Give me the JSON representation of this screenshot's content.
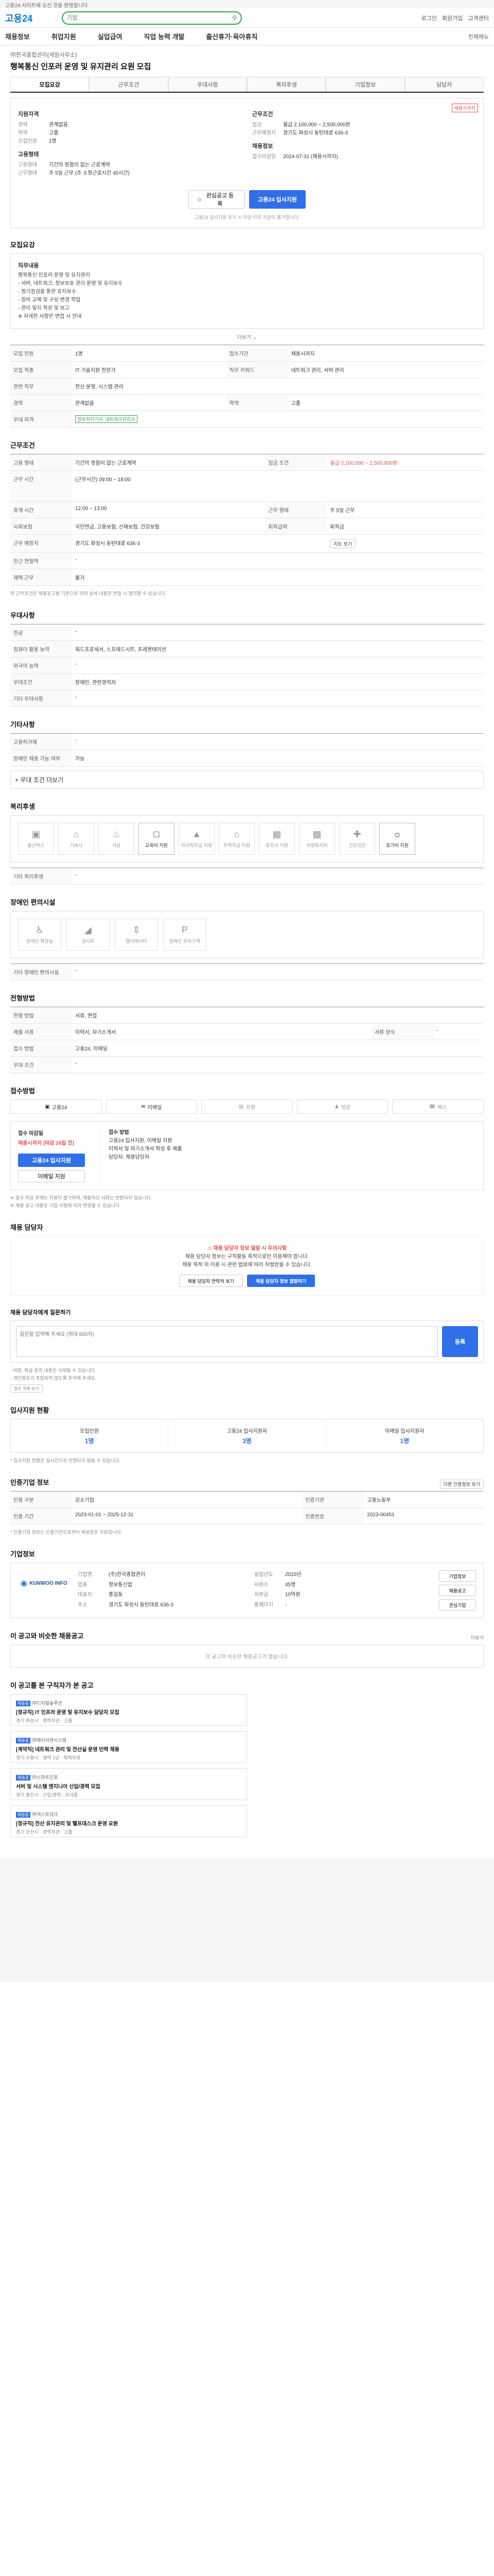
{
  "notice": "고용24 사이트에 오신 것을 환영합니다",
  "header": {
    "logo": "고용24",
    "search_placeholder": "기업",
    "links": [
      "로그인",
      "회원가입",
      "고객센터"
    ]
  },
  "gnb": {
    "items": [
      "채용정보",
      "취업지원",
      "실업급여",
      "직업 능력 개발",
      "출산휴가·육아휴직"
    ],
    "right": "전체메뉴"
  },
  "job": {
    "company": "㈜한국종합관리(세원사무소)",
    "title": "행복통신 인포러 운영 및 유지관리 요원 모집"
  },
  "tabs": [
    "모집요강",
    "근무조건",
    "우대사항",
    "복리후생",
    "기업정보",
    "담당자"
  ],
  "summary": {
    "badge": "채용시까지",
    "left_title": "지원자격",
    "left_rows": [
      {
        "k": "경력",
        "v": "관계없음"
      },
      {
        "k": "학력",
        "v": "고졸"
      },
      {
        "k": "모집인원",
        "v": "1명"
      }
    ],
    "left_title2": "고용형태",
    "left_rows2": [
      {
        "k": "고용형태",
        "v": "기간의 정함이 없는 근로계약"
      },
      {
        "k": "근무형태",
        "v": "주 5일 근무 (주 소정근로시간 40시간)"
      }
    ],
    "right_title": "근무조건",
    "right_rows": [
      {
        "k": "임금",
        "v": "월급 2,100,000 ~ 2,500,000원"
      },
      {
        "k": "근무예정지",
        "v": "경기도 화성시 동탄대로 636-3"
      }
    ],
    "right_title2": "채용정보",
    "right_rows2": [
      {
        "k": "접수마감일",
        "v": "2024-07-31 (채용시까지)"
      }
    ],
    "btn_scrap": "관심공고 등록",
    "btn_apply": "고용24 입사지원",
    "note": "고용24 입사지원 포기 시 마감 이후 지원이 불가합니다."
  },
  "sections": {
    "recruit": "모집요강",
    "conditions": "근무조건",
    "preferred": "우대사항",
    "etc": "기타사항",
    "welfare": "복리후생",
    "barrier": "장애인 편의시설",
    "method": "전형방법",
    "process": "접수방법",
    "report": "채용 담당자",
    "qa": "입사지원 Q&A",
    "status": "입사지원 현황",
    "homepage": "인증기업 정보",
    "company": "기업정보",
    "similar": "이 공고와 비슷한 채용공고"
  },
  "duty": {
    "title": "직무내용",
    "lines": [
      "행복통신 인포러 운영 및 유지관리",
      "- 서버, 네트워크, 정보보호 관리 운영 및 유지보수",
      "- 정기점검을 통한 유지보수",
      "- 장비 교체 및 구성 변경 작업",
      "- 관리 일지 작성 및 보고",
      "※ 자세한 사항은 면접 시 안내"
    ],
    "more": "더보기"
  },
  "recruit_table": [
    {
      "k": "모집 인원",
      "v": "1명",
      "k2": "접수기간",
      "v2": "채용시까지"
    },
    {
      "k": "모집 직종",
      "v": "IT 기술지원 전문가",
      "k2": "직무 키워드",
      "v2": "네트워크 관리, 서버 관리"
    },
    {
      "k": "관련 직무",
      "v": "전산 운영, 시스템 관리",
      "k2": "",
      "v2": ""
    },
    {
      "k": "경력",
      "v": "관계없음",
      "k2": "학력",
      "v2": "고졸"
    },
    {
      "k": "우대 자격",
      "v": "정보처리기사, 네트워크관리사",
      "k2": "",
      "v2": ""
    }
  ],
  "cond_table": [
    {
      "k": "고용 형태",
      "v": "기간의 정함이 없는 근로계약",
      "k2": "임금 조건",
      "v2": "월급 2,100,000 ~ 2,500,000원"
    },
    {
      "k": "근무 시간",
      "v": "(근무시간) 09:00 ~ 18:00",
      "k2": "",
      "v2": ""
    },
    {
      "k": "휴게 시간",
      "v": "12:00 ~ 13:00",
      "k2": "근무 형태",
      "v2": "주 5일 근무"
    },
    {
      "k": "사회보험",
      "v": "국민연금, 고용보험, 산재보험, 건강보험",
      "k2": "퇴직급여",
      "v2": "퇴직금"
    },
    {
      "k": "근무 예정지",
      "v": "경기도 화성시 동탄대로 636-3",
      "k2": "",
      "v2": "지도 보기"
    },
    {
      "k": "인근 전철역",
      "v": "-",
      "k2": "",
      "v2": ""
    },
    {
      "k": "재택 근무",
      "v": "불가",
      "k2": "",
      "v2": ""
    }
  ],
  "cond_note": "위 근무조건은 채용공고를 기준으로 하며 상세 내용은 면접 시 협의할 수 있습니다.",
  "pref_table": [
    {
      "k": "전공",
      "v": "-"
    },
    {
      "k": "컴퓨터 활용 능력",
      "v": "워드프로세서, 스프레드시트, 프레젠테이션"
    },
    {
      "k": "외국어 능력",
      "v": "-"
    },
    {
      "k": "우대조건",
      "v": "장애인, 관련경력자"
    },
    {
      "k": "기타 우대사항",
      "v": "-"
    }
  ],
  "etc_table": [
    {
      "k": "고용허가제",
      "v": "-"
    },
    {
      "k": "장애인 채용 가능 여부",
      "v": "가능"
    }
  ],
  "etc_more": "우대 조건 더보기",
  "welfare": [
    {
      "name": "통근버스",
      "on": false
    },
    {
      "name": "기숙사",
      "on": false
    },
    {
      "name": "식당",
      "on": false
    },
    {
      "name": "교육비 지원",
      "on": true
    },
    {
      "name": "자녀학자금 지원",
      "on": false
    },
    {
      "name": "주택자금 지원",
      "on": false
    },
    {
      "name": "경조사 지원",
      "on": false
    },
    {
      "name": "차량유지비",
      "on": false
    },
    {
      "name": "건강검진",
      "on": false
    },
    {
      "name": "휴가비 지원",
      "on": true
    }
  ],
  "welfare_etc_label": "기타 복리후생",
  "welfare_etc": "-",
  "barrier": [
    "장애인 화장실",
    "경사로",
    "엘리베이터",
    "장애인 주차구역"
  ],
  "barrier_etc_label": "기타 장애인 편의시설",
  "barrier_etc": "-",
  "method_table": [
    {
      "k": "전형 방법",
      "v": "서류, 면접"
    },
    {
      "k": "제출 서류",
      "v": "이력서, 자기소개서",
      "k2": "서류 양식",
      "v2": "-"
    },
    {
      "k": "접수 방법",
      "v": "고용24, 이메일"
    },
    {
      "k": "우대 조건",
      "v": "-"
    }
  ],
  "methods": [
    {
      "name": "고용24",
      "on": true
    },
    {
      "name": "이메일",
      "on": true
    },
    {
      "name": "우편",
      "on": false
    },
    {
      "name": "방문",
      "on": false
    },
    {
      "name": "팩스",
      "on": false
    }
  ],
  "deadline": {
    "label": "접수 마감일",
    "date": "채용시까지 (마감 26일 전)",
    "btn_apply": "고용24 입사지원",
    "btn_mail": "이메일 지원",
    "right_title": "접수 방법",
    "right_lines": [
      "고용24 입사지원, 이메일 지원",
      "이력서 및 자기소개서 작성 후 제출",
      "담당자: 채용담당자"
    ]
  },
  "deadline_notes": [
    "※ 접수 마감 후에는 지원이 불가하며, 제출하신 서류는 반환되지 않습니다.",
    "※ 채용 공고 내용은 기업 사정에 따라 변경될 수 있습니다."
  ],
  "report": {
    "title": "채용 담당자 정보 열람 시 주의사항",
    "lines": [
      "채용 담당자 정보는 구직활동 목적으로만 이용해야 합니다.",
      "채용 목적 외 이용 시 관련 법령에 따라 처벌받을 수 있습니다."
    ],
    "btn1": "채용 담당자 연락처 보기",
    "btn2": "채용 담당자 정보 열람하기"
  },
  "qa": {
    "title": "채용 담당자에게 질문하기",
    "placeholder": "질문을 입력해 주세요 (최대 500자)",
    "btn": "등록",
    "notes": [
      "- 비방, 욕설 등의 내용은 삭제될 수 있습니다.",
      "- 개인정보가 포함되지 않도록 주의해 주세요."
    ],
    "more": "질문 목록 보기"
  },
  "status": [
    {
      "label": "모집인원",
      "value": "1명"
    },
    {
      "label": "고용24 입사지원자",
      "value": "3명"
    },
    {
      "label": "이메일 입사지원자",
      "value": "1명"
    }
  ],
  "status_note": "* 입사지원 현황은 실시간으로 반영되지 않을 수 있습니다.",
  "cert": {
    "more": "다른 인증정보 보기",
    "rows": [
      {
        "k": "인증 구분",
        "v": "강소기업",
        "k2": "인증기관",
        "v2": "고용노동부"
      },
      {
        "k": "인증 기간",
        "v": "2023-01-01 ~ 2025-12-31",
        "k2": "인증번호",
        "v2": "2023-00451"
      }
    ],
    "note": "* 인증기업 정보는 인증기관으로부터 제공받은 자료입니다."
  },
  "company": {
    "logo": "KUNWOO INFO",
    "rows": [
      {
        "k": "기업명",
        "v": "(주)한국종합관리"
      },
      {
        "k": "설립년도",
        "v": "2015년"
      },
      {
        "k": "업종",
        "v": "정보통신업"
      },
      {
        "k": "사원수",
        "v": "45명"
      },
      {
        "k": "대표자",
        "v": "홍길동"
      },
      {
        "k": "자본금",
        "v": "10억원"
      },
      {
        "k": "주소",
        "v": "경기도 화성시 동탄대로 636-3"
      },
      {
        "k": "홈페이지",
        "v": "-"
      }
    ],
    "btn1": "기업정보",
    "btn2": "채용공고",
    "btn3": "관심기업"
  },
  "similar_empty": "이 공고와 비슷한 채용공고가 없습니다.",
  "similar_more": "더보기",
  "recommend_title": "이 공고를 본 구직자가 본 공고",
  "recommend": [
    {
      "tag": "채용중",
      "co": "㈜디지털솔루션",
      "title": "[정규직] IT 인프라 운영 및 유지보수 담당자 모집",
      "meta": "경기 화성시 · 경력무관 · 고졸"
    },
    {
      "tag": "채용중",
      "co": "㈜에이치앤시스템",
      "title": "[계약직] 네트워크 관리 및 전산실 운영 인력 채용",
      "meta": "경기 수원시 · 경력 1년 · 학력무관"
    },
    {
      "tag": "채용중",
      "co": "㈜스마트인포",
      "title": "서버 및 시스템 엔지니어 신입/경력 모집",
      "meta": "경기 용인시 · 신입/경력 · 초대졸"
    },
    {
      "tag": "채용중",
      "co": "㈜넥스트테크",
      "title": "[정규직] 전산 유지관리 및 헬프데스크 운영 요원",
      "meta": "경기 오산시 · 경력무관 · 고졸"
    }
  ]
}
